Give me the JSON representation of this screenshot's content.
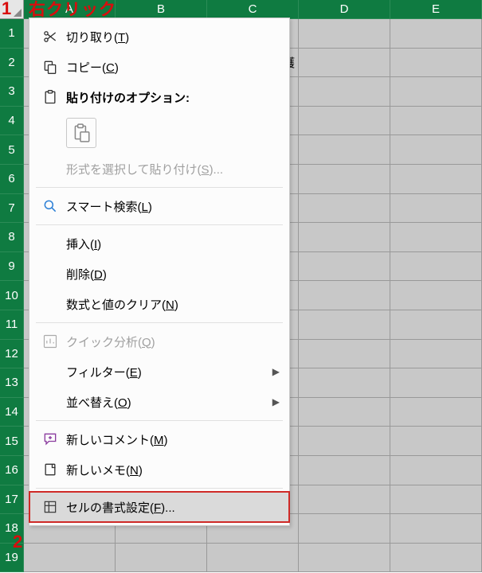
{
  "columns": [
    "A",
    "B",
    "C",
    "D",
    "E"
  ],
  "rows": [
    "1",
    "2",
    "3",
    "4",
    "5",
    "6",
    "7",
    "8",
    "9",
    "10",
    "11",
    "12",
    "13",
    "14",
    "15",
    "16",
    "17",
    "18",
    "19"
  ],
  "visible_cell_text": "護",
  "annotations": {
    "step1_num": "1",
    "step1_text": "右クリック",
    "step2_num": "2"
  },
  "menu": {
    "cut": "切り取り(",
    "cut_k": "T",
    "cut_suf": ")",
    "copy": "コピー(",
    "copy_k": "C",
    "copy_suf": ")",
    "paste_hdr": "貼り付けのオプション:",
    "paste_special": "形式を選択して貼り付け(",
    "paste_special_k": "S",
    "paste_special_s": ")...",
    "smart": "スマート検索(",
    "smart_k": "L",
    "smart_s": ")",
    "insert": "挿入(",
    "insert_k": "I",
    "insert_s": ")",
    "delete": "削除(",
    "delete_k": "D",
    "delete_s": ")",
    "clear": "数式と値のクリア(",
    "clear_k": "N",
    "clear_s": ")",
    "quick": "クイック分析(",
    "quick_k": "Q",
    "quick_s": ")",
    "filter": "フィルター(",
    "filter_k": "E",
    "filter_s": ")",
    "sort": "並べ替え(",
    "sort_k": "O",
    "sort_s": ")",
    "newcomment": "新しいコメント(",
    "newcomment_k": "M",
    "newcomment_s": ")",
    "newnote": "新しいメモ(",
    "newnote_k": "N",
    "newnote_s": ")",
    "format": "セルの書式設定(",
    "format_k": "F",
    "format_s": ")...",
    "arrow": "▶"
  }
}
